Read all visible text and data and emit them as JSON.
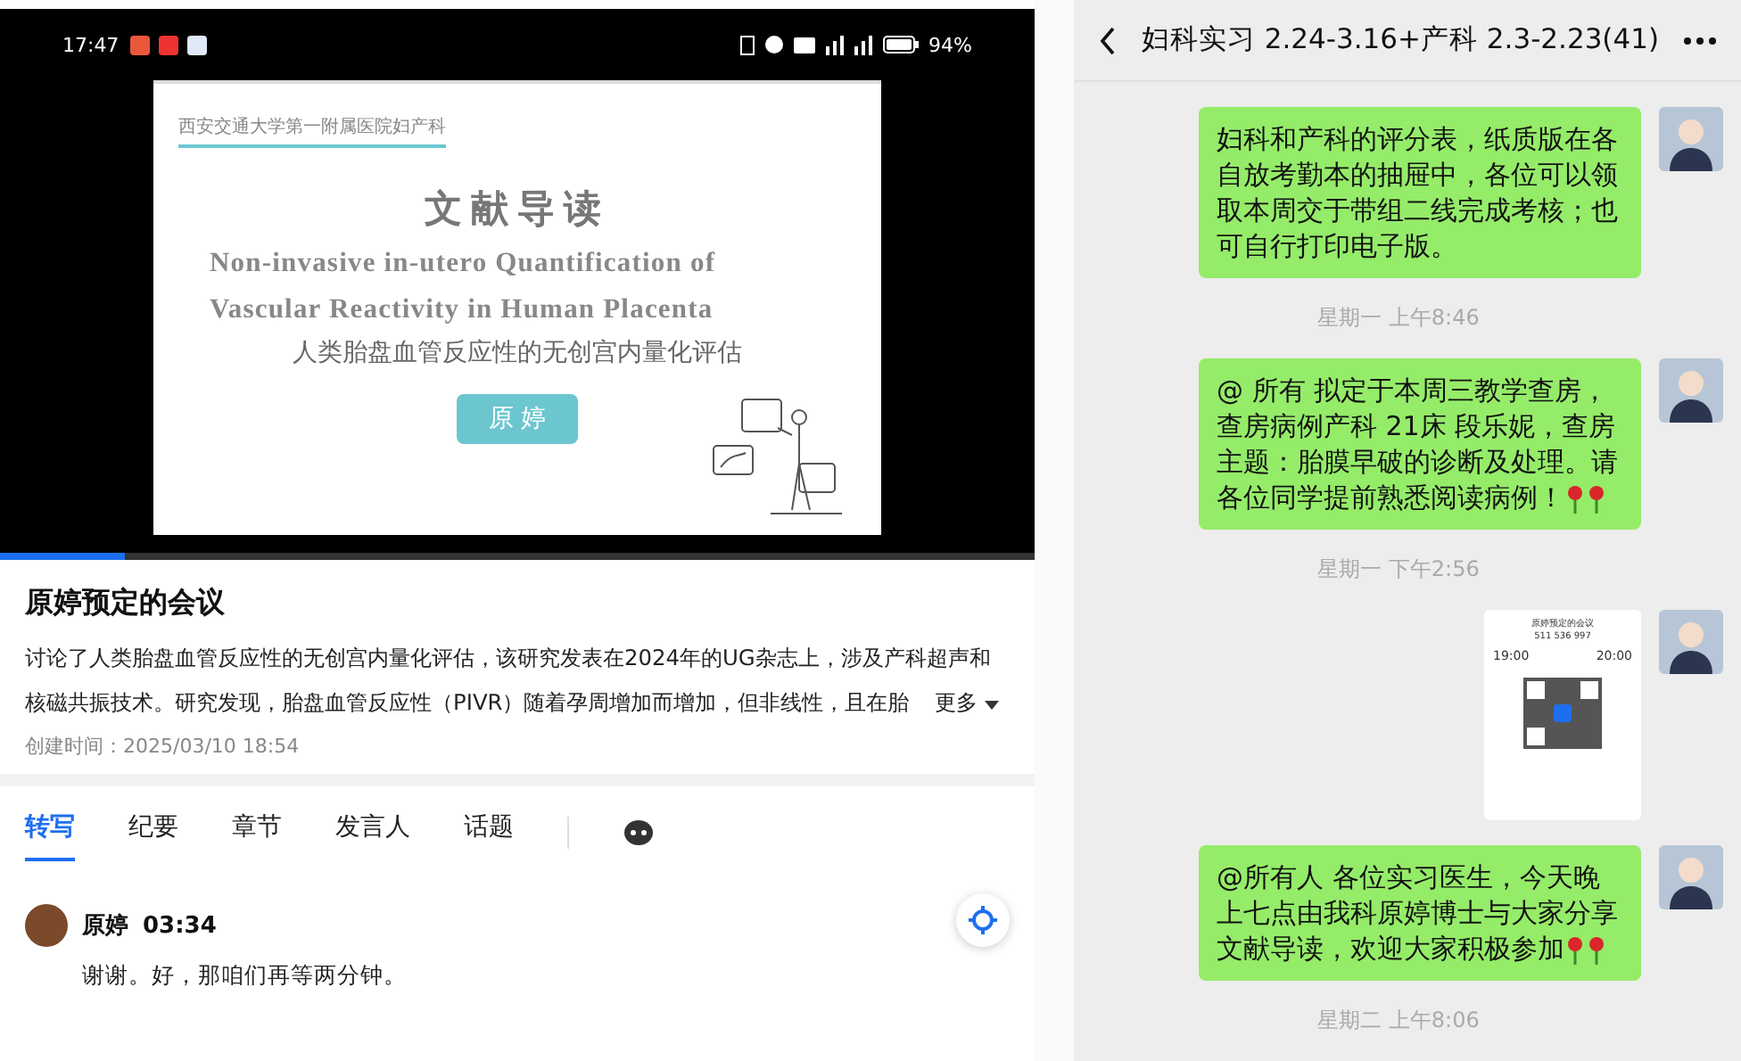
{
  "meeting_app": {
    "status_bar": {
      "time": "17:47",
      "battery": "94%"
    },
    "slide": {
      "institution": "西安交通大学第一附属医院妇产科",
      "heading": "文献导读",
      "english_title": "Non-invasive in-utero Quantification of Vascular Reactivity in Human Placenta",
      "chinese_title": "人类胎盘血管反应性的无创宫内量化评估",
      "presenter": "原 婷"
    },
    "playback": {
      "level": 0.12
    },
    "title": "原婷预定的会议",
    "description": "讨论了人类胎盘血管反应性的无创宫内量化评估，该研究发表在2024年的UG杂志上，涉及产科超声和核磁共振技术。研究发现，胎盘血管反应性（PIVR）随着孕周增加而增加，但非线性，且在胎",
    "more": "更多",
    "created": "创建时间：2025/03/10 18:54",
    "tabs": [
      {
        "label": "转写",
        "selected": true
      },
      {
        "label": "纪要",
        "selected": false
      },
      {
        "label": "章节",
        "selected": false
      },
      {
        "label": "发言人",
        "selected": false
      },
      {
        "label": "话题",
        "selected": false
      }
    ],
    "transcript": [
      {
        "speaker": "原婷",
        "time": "03:34",
        "text": "谢谢。好，那咱们再等两分钟。"
      }
    ]
  },
  "chat": {
    "title": "妇科实习 2.24-3.16+产科 2.3-2.23(41)",
    "messages": [
      {
        "kind": "text",
        "text": "妇科和产科的评分表，纸质版在各自放考勤本的抽屉中，各位可以领取本周交于带组二线完成考核；也可自行打印电子版。"
      },
      {
        "kind": "time",
        "text": "星期一 上午8:46"
      },
      {
        "kind": "text",
        "text": "@ 所有 拟定于本周三教学查房，查房病例产科 21床 段乐妮，查房主题：胎膜早破的诊断及处理。请各位同学提前熟悉阅读病例！",
        "icons": [
          {
            "kind": "rose"
          },
          {
            "kind": "rose"
          }
        ]
      },
      {
        "kind": "time",
        "text": "星期一 下午2:56"
      },
      {
        "kind": "card",
        "title": "原婷预定的会议",
        "number": "511 536 997",
        "start": "19:00",
        "end": "20:00"
      },
      {
        "kind": "text",
        "text": "@所有人  各位实习医生，今天晚上七点由我科原婷博士与大家分享文献导读，欢迎大家积极参加",
        "icons": [
          {
            "kind": "rose"
          },
          {
            "kind": "rose"
          }
        ]
      },
      {
        "kind": "time",
        "text": "星期二 上午8:06"
      }
    ]
  }
}
